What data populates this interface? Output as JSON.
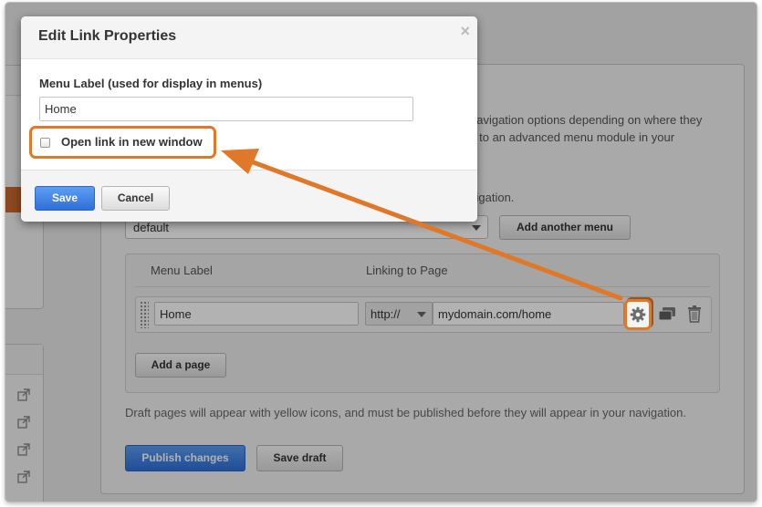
{
  "background_page": {
    "description_lines": [
      "navigation options depending on where they",
      "it to an advanced menu module in your"
    ],
    "description_tail": "vigation.",
    "menu_select_value": "default",
    "add_menu_button": "Add another menu",
    "table": {
      "col_menu_label": "Menu Label",
      "col_linking": "Linking to Page",
      "row": {
        "label": "Home",
        "protocol": "http://",
        "url": "mydomain.com/home"
      }
    },
    "add_page_button": "Add a page",
    "draft_note": "Draft pages will appear with yellow icons, and must be published before they will appear in your navigation.",
    "publish_button": "Publish changes",
    "save_draft_button": "Save draft"
  },
  "modal": {
    "title": "Edit Link Properties",
    "close_glyph": "×",
    "menu_label_caption": "Menu Label (used for display in menus)",
    "menu_label_value": "Home",
    "open_new_window_label": "Open link in new window",
    "open_new_window_checked": false,
    "save_button": "Save",
    "cancel_button": "Cancel"
  },
  "colors": {
    "annotation_orange": "#e0782a",
    "primary_blue": "#2f6fd8"
  },
  "icons": [
    "external-link-icon",
    "drag-handle-icon",
    "gear-icon",
    "duplicate-icon",
    "trash-icon",
    "close-icon"
  ]
}
